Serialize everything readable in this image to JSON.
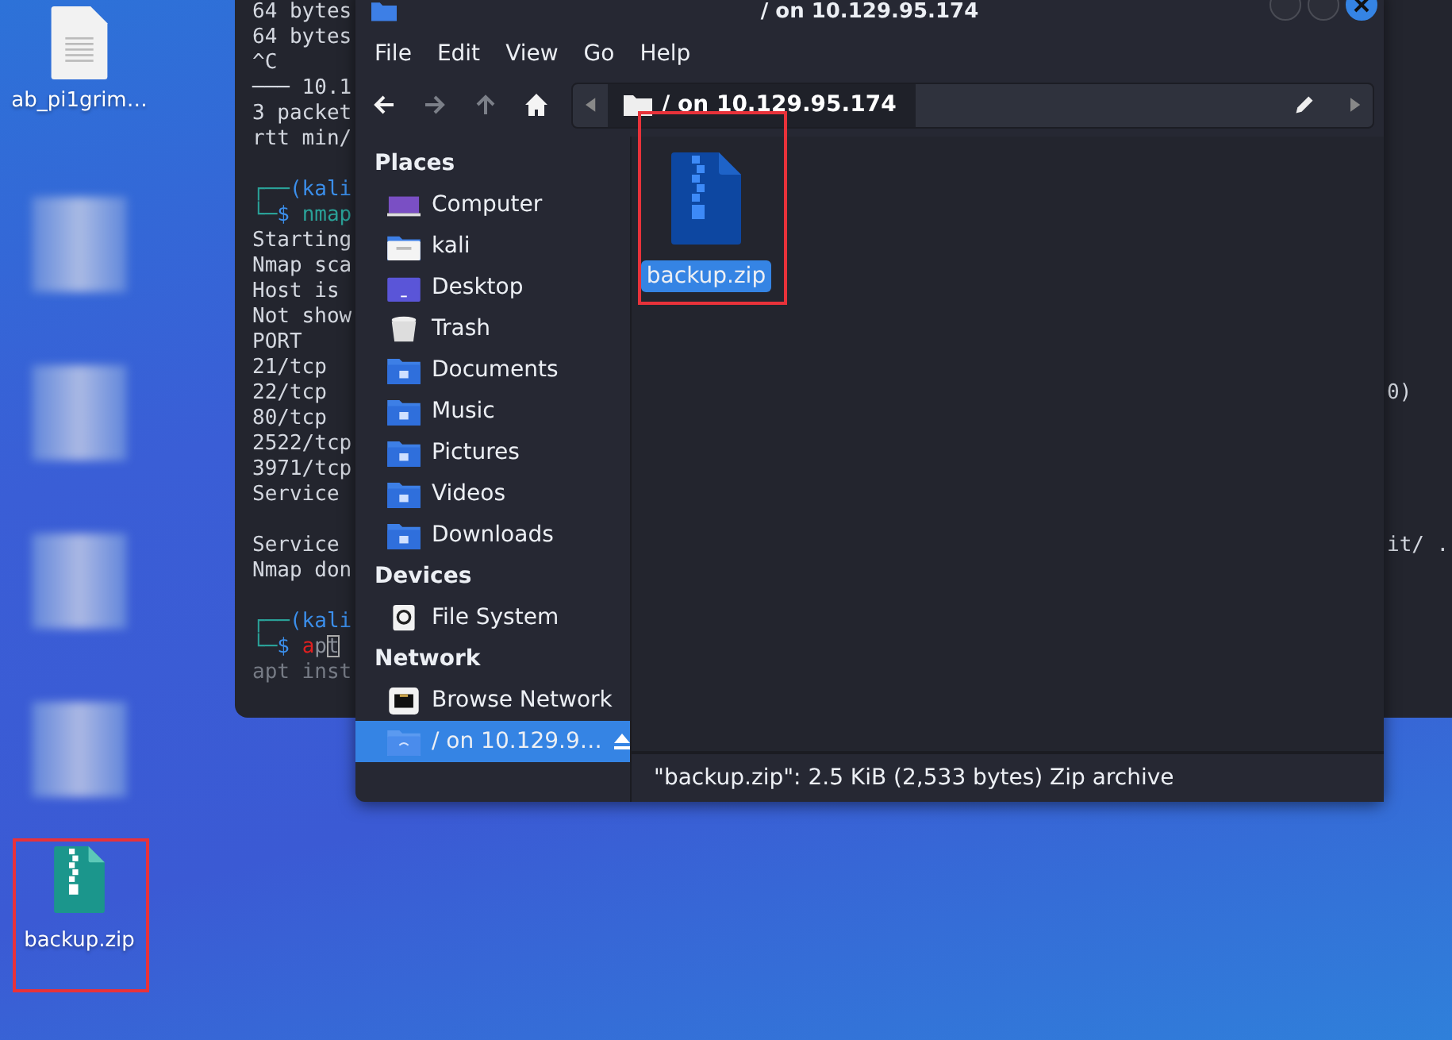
{
  "desktop": {
    "icons": [
      {
        "kind": "document",
        "label": "ab_pi1grim…"
      },
      {
        "kind": "blurred"
      },
      {
        "kind": "blurred"
      },
      {
        "kind": "blurred"
      },
      {
        "kind": "blurred"
      },
      {
        "kind": "zip",
        "label": "backup.zip",
        "highlighted": true
      }
    ]
  },
  "terminal": {
    "lines": [
      {
        "parts": [
          {
            "text": "64 bytes",
            "color": "#d3d7df"
          }
        ]
      },
      {
        "parts": [
          {
            "text": "64 bytes",
            "color": "#d3d7df"
          }
        ]
      },
      {
        "parts": [
          {
            "text": "^C",
            "color": "#d3d7df"
          }
        ]
      },
      {
        "parts": [
          {
            "text": "─── 10.1",
            "color": "#d3d7df"
          }
        ]
      },
      {
        "parts": [
          {
            "text": "3 packet",
            "color": "#d3d7df"
          }
        ]
      },
      {
        "parts": [
          {
            "text": "rtt min/",
            "color": "#d3d7df"
          }
        ]
      },
      {
        "blank_before": true,
        "parts": [
          {
            "text": "┌──",
            "color": "#2aa198"
          },
          {
            "text": "(kali",
            "color": "#3b8eea"
          }
        ]
      },
      {
        "parts": [
          {
            "text": "└─",
            "color": "#2aa198"
          },
          {
            "text": "$ ",
            "color": "#3b8eea"
          },
          {
            "text": "nmap",
            "color": "#2aa198"
          }
        ]
      },
      {
        "parts": [
          {
            "text": "Starting",
            "color": "#d3d7df"
          }
        ]
      },
      {
        "parts": [
          {
            "text": "Nmap sca",
            "color": "#d3d7df"
          }
        ]
      },
      {
        "parts": [
          {
            "text": "Host is",
            "color": "#d3d7df"
          }
        ]
      },
      {
        "parts": [
          {
            "text": "Not show",
            "color": "#d3d7df"
          }
        ]
      },
      {
        "parts": [
          {
            "text": "PORT",
            "color": "#d3d7df"
          }
        ]
      },
      {
        "parts": [
          {
            "text": "21/tcp",
            "color": "#d3d7df"
          }
        ]
      },
      {
        "parts": [
          {
            "text": "22/tcp",
            "color": "#d3d7df"
          }
        ],
        "tail": "0)"
      },
      {
        "parts": [
          {
            "text": "80/tcp",
            "color": "#d3d7df"
          }
        ]
      },
      {
        "parts": [
          {
            "text": "2522/tcp",
            "color": "#d3d7df"
          }
        ]
      },
      {
        "parts": [
          {
            "text": "3971/tcp",
            "color": "#d3d7df"
          }
        ]
      },
      {
        "parts": [
          {
            "text": "Service",
            "color": "#d3d7df"
          }
        ]
      },
      {
        "blank_before": true,
        "parts": [
          {
            "text": "Service",
            "color": "#d3d7df"
          }
        ],
        "tail": "it/ ."
      },
      {
        "parts": [
          {
            "text": "Nmap don",
            "color": "#d3d7df"
          }
        ]
      },
      {
        "blank_before": true,
        "parts": [
          {
            "text": "┌──",
            "color": "#2aa198"
          },
          {
            "text": "(kali",
            "color": "#3b8eea"
          }
        ]
      },
      {
        "parts": [
          {
            "text": "└─",
            "color": "#2aa198"
          },
          {
            "text": "$ ",
            "color": "#3b8eea"
          },
          {
            "text": "a",
            "color": "#e02020"
          },
          {
            "text": "pt",
            "color": "#8a8f99"
          }
        ],
        "cursor": true
      },
      {
        "parts": [
          {
            "text": "apt inst",
            "color": "#767b85"
          }
        ]
      }
    ]
  },
  "file_manager": {
    "title": "/ on 10.129.95.174",
    "menu": [
      "File",
      "Edit",
      "View",
      "Go",
      "Help"
    ],
    "toolbar": [
      {
        "kind": "back",
        "disabled": false
      },
      {
        "kind": "forward",
        "disabled": true
      },
      {
        "kind": "up",
        "disabled": true
      },
      {
        "kind": "home",
        "disabled": false
      }
    ],
    "path": {
      "crumb": "/ on 10.129.95.174"
    },
    "sidebar": [
      {
        "header": "Places",
        "items": [
          {
            "kind": "computer",
            "label": "Computer",
            "selected": false
          },
          {
            "kind": "home",
            "label": "kali",
            "selected": false
          },
          {
            "kind": "desktop",
            "label": "Desktop",
            "selected": false
          },
          {
            "kind": "trash",
            "label": "Trash",
            "selected": false
          },
          {
            "kind": "documents",
            "label": "Documents",
            "selected": false
          },
          {
            "kind": "music",
            "label": "Music",
            "selected": false
          },
          {
            "kind": "pictures",
            "label": "Pictures",
            "selected": false
          },
          {
            "kind": "videos",
            "label": "Videos",
            "selected": false
          },
          {
            "kind": "downloads",
            "label": "Downloads",
            "selected": false
          }
        ]
      },
      {
        "header": "Devices",
        "items": [
          {
            "kind": "drive",
            "label": "File System",
            "selected": false
          }
        ]
      },
      {
        "header": "Network",
        "items": [
          {
            "kind": "network",
            "label": "Browse Network",
            "selected": false
          },
          {
            "kind": "share",
            "label": "/ on 10.129.9…",
            "selected": true,
            "eject": true
          }
        ]
      }
    ],
    "files": [
      {
        "name": "backup.zip",
        "selected": true,
        "highlighted": true
      }
    ],
    "status": "\"backup.zip\": 2.5 KiB (2,533 bytes) Zip archive"
  }
}
